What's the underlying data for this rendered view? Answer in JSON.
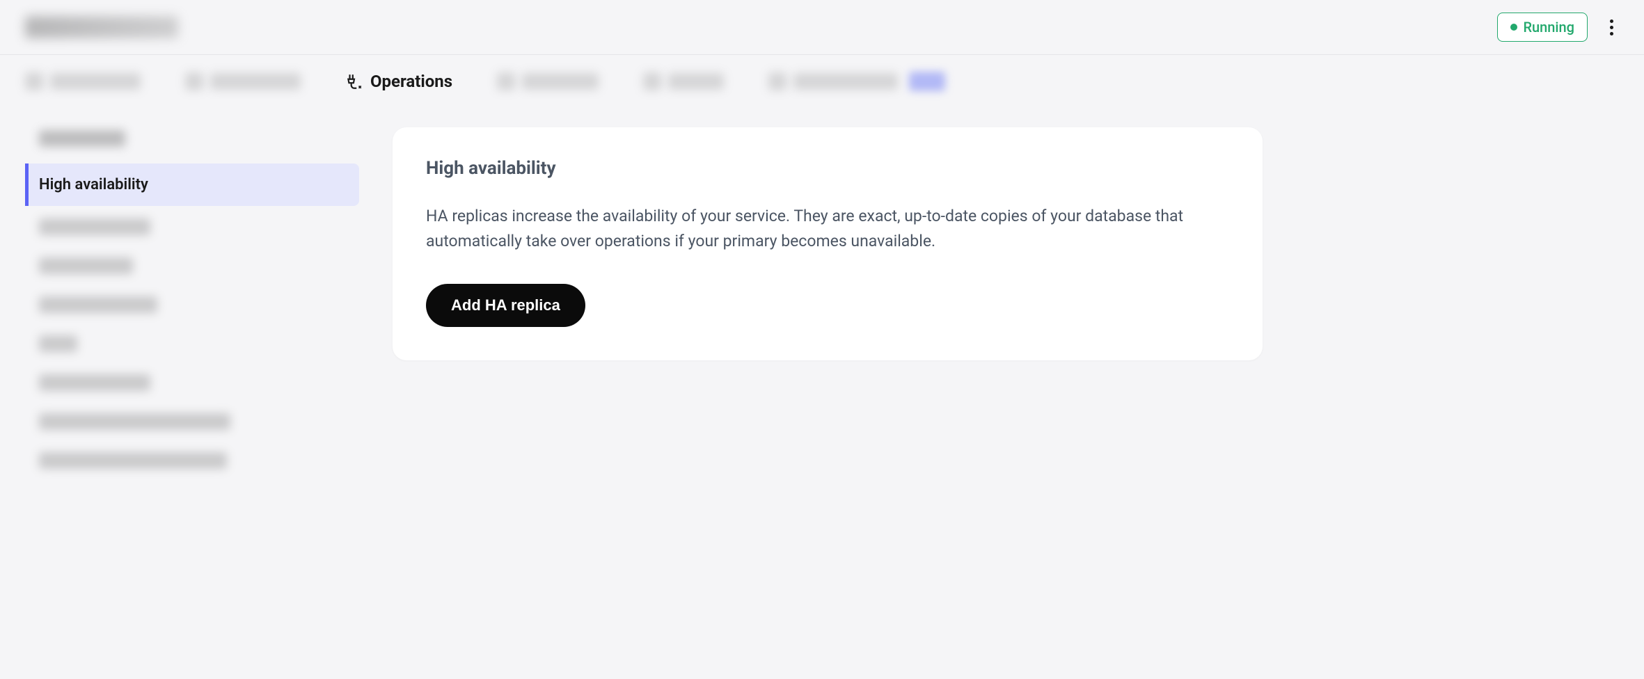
{
  "header": {
    "status_label": "Running"
  },
  "tabs": {
    "active_label": "Operations"
  },
  "sidebar": {
    "active_item_label": "High availability"
  },
  "card": {
    "title": "High availability",
    "description": "HA replicas increase the availability of your service. They are exact, up-to-date copies of your database that automatically take over operations if your primary becomes unavailable.",
    "button_label": "Add HA replica"
  }
}
